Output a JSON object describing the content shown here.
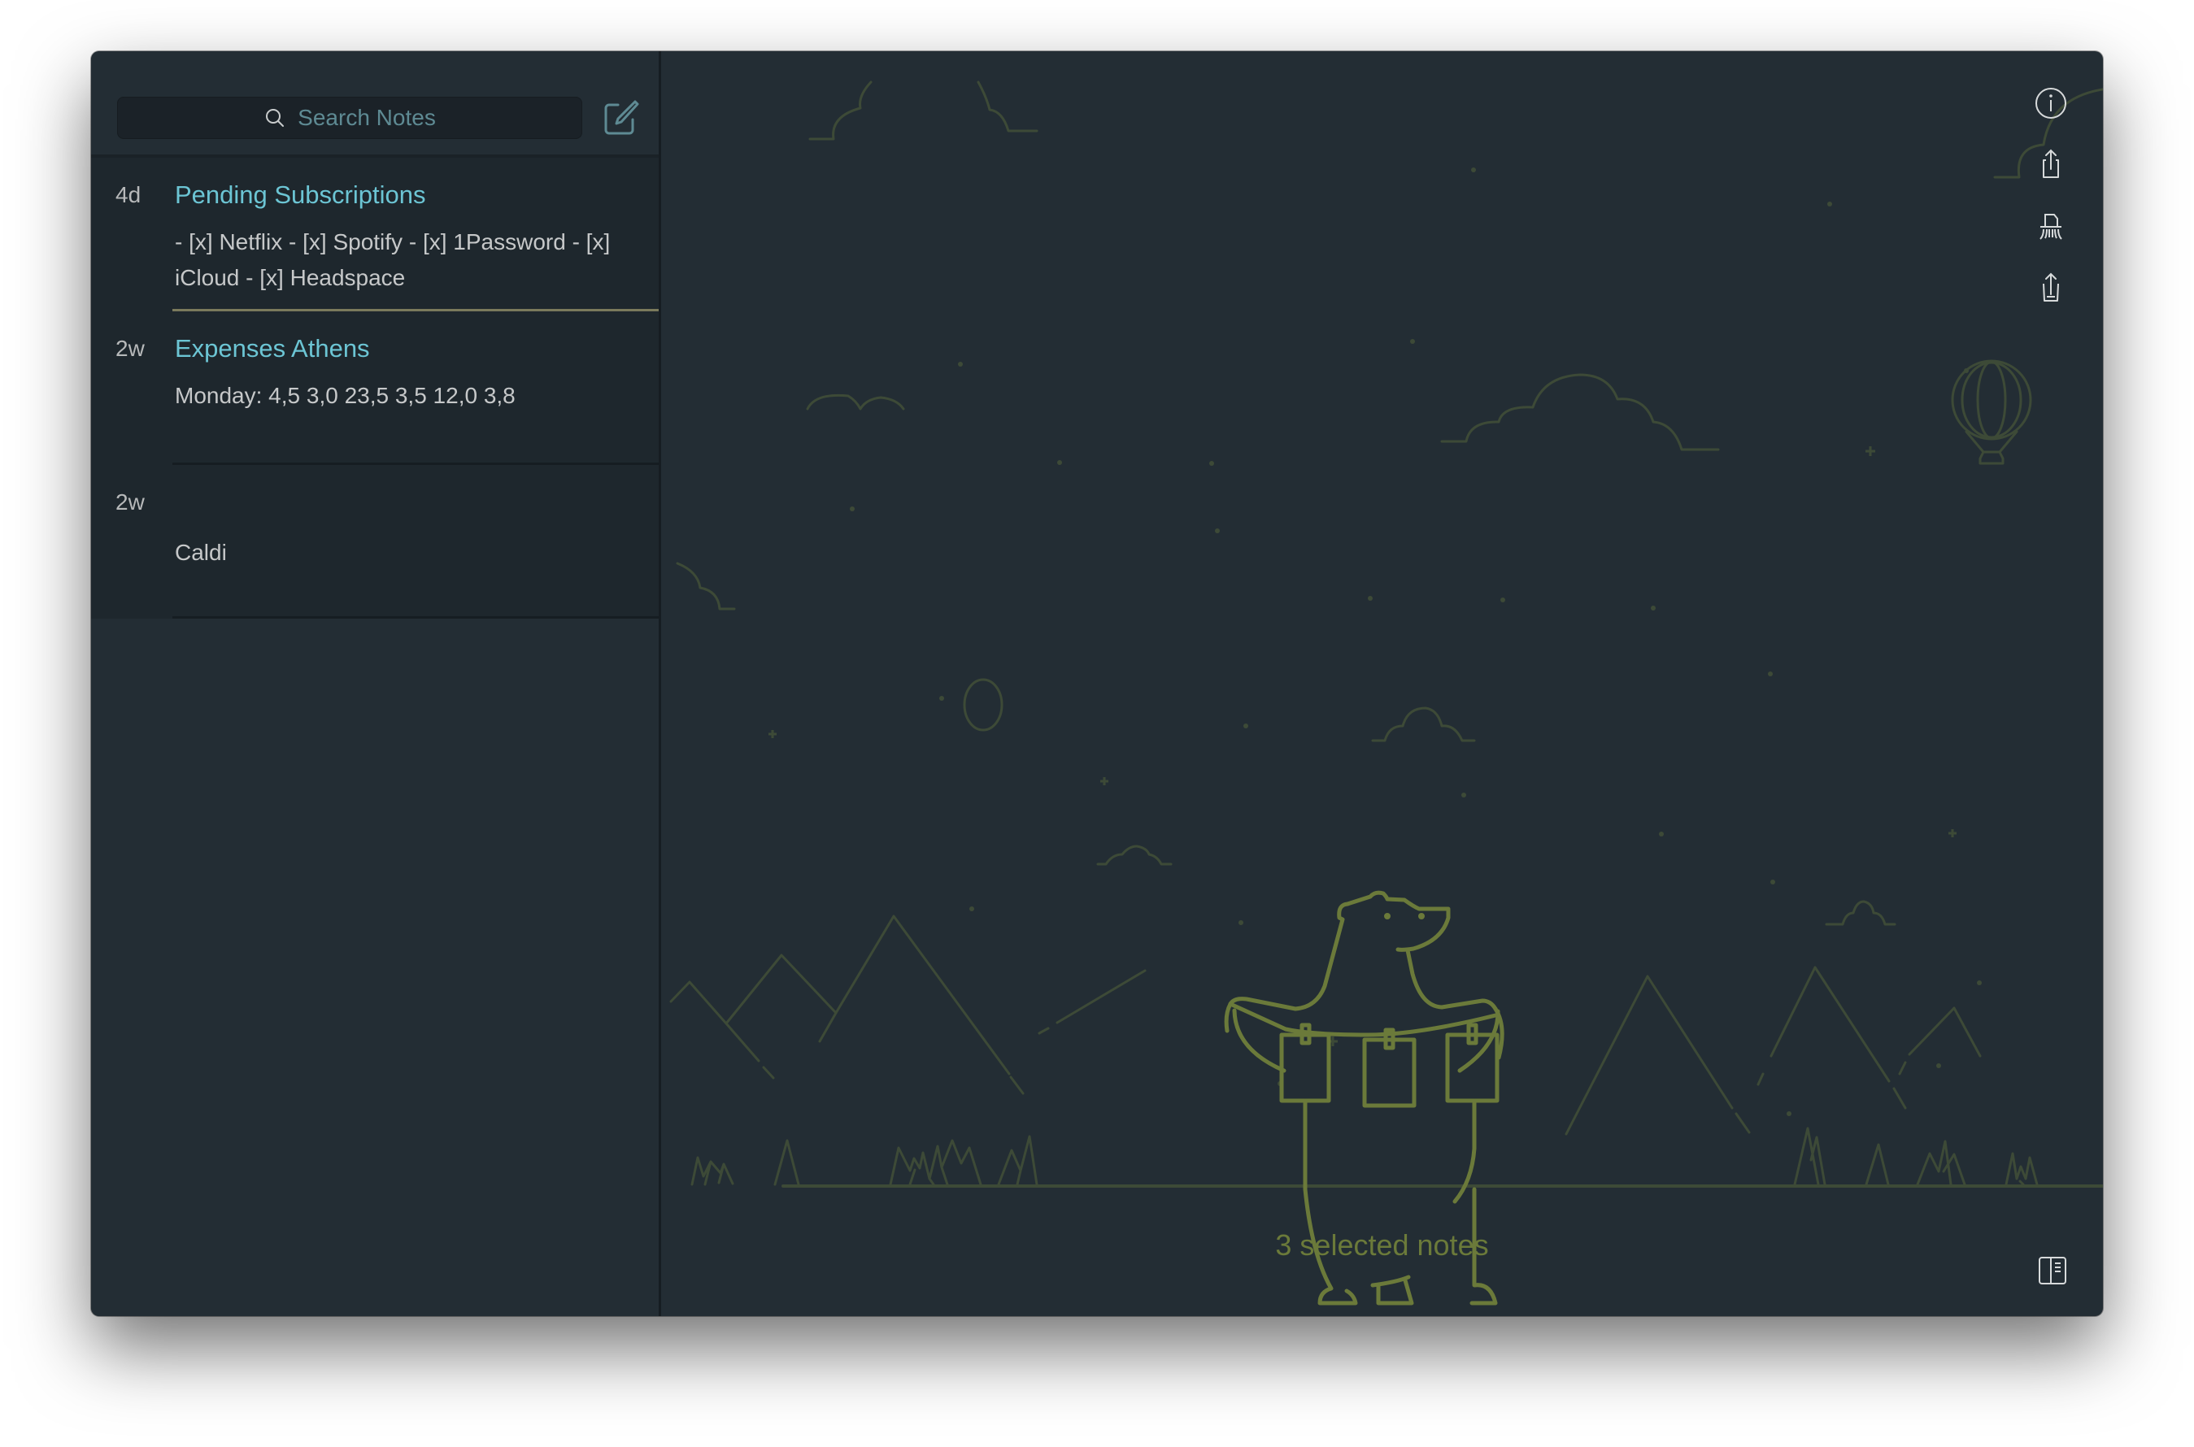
{
  "window": {
    "traffic_lights": [
      "close",
      "minimize",
      "zoom"
    ]
  },
  "sidebar": {
    "search": {
      "placeholder": "Search Notes",
      "icon": "search-icon"
    },
    "compose_icon": "compose-icon",
    "notes": [
      {
        "age": "4d",
        "title": "Pending Subscriptions",
        "preview": "- [x] Netflix - [x] Spotify - [x] 1Password - [x] iCloud - [x] Headspace",
        "selected": true
      },
      {
        "age": "2w",
        "title": "Expenses Athens",
        "preview": "Monday: 4,5 3,0 23,5 3,5 12,0 3,8",
        "selected": true
      },
      {
        "age": "2w",
        "title": "",
        "preview": "Caldi",
        "selected": true
      }
    ]
  },
  "main": {
    "status": "3 selected notes",
    "actions": [
      {
        "name": "info",
        "icon": "info-icon"
      },
      {
        "name": "share",
        "icon": "share-icon"
      },
      {
        "name": "delete",
        "icon": "shredder-icon"
      },
      {
        "name": "export",
        "icon": "export-icon"
      }
    ],
    "toggle_sidebar_icon": "sidebar-toggle-icon"
  },
  "colors": {
    "background": "#232d34",
    "title_accent": "#6cc5d4",
    "selection_bar": "#c8c07f",
    "illustration": "#6b7a3a",
    "illustration_dim": "#3d4a37"
  }
}
